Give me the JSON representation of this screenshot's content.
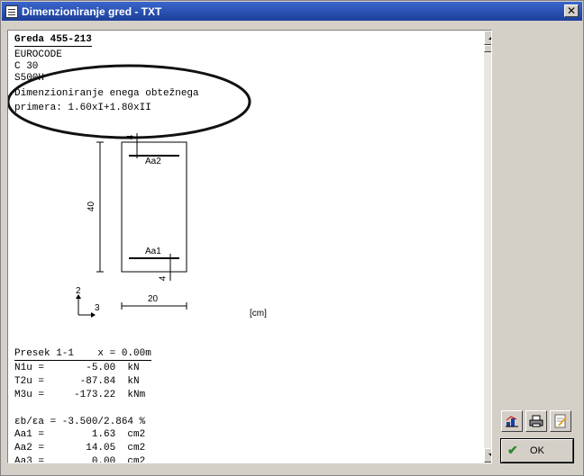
{
  "window": {
    "title": "Dimenzioniranje gred - TXT",
    "close": "✕"
  },
  "doc": {
    "heading": "Greda 455-213",
    "lines": [
      "EUROCODE",
      "C 30",
      "S500H",
      "Dimenzioniranje enega obtežnega",
      "primera: 1.60xI+1.80xII"
    ]
  },
  "figure": {
    "height_label": "40",
    "width_label": "20",
    "top_cover": "4",
    "bottom_cover": "4",
    "aa2": "Aa2",
    "aa1": "Aa1",
    "axis_2": "2",
    "axis_3": "3",
    "unit": "[cm]"
  },
  "section": {
    "header": "Presek 1-1    x = 0.00m",
    "rows": [
      "N1u =       -5.00  kN",
      "T2u =      -87.84  kN",
      "M3u =     -173.22  kNm",
      "",
      "εb/εa = -3.500/2.864 %",
      "Aa1 =        1.63  cm2",
      "Aa2 =       14.05  cm2",
      "Aa3 =        0.00  cm2"
    ]
  },
  "buttons": {
    "ok": "OK"
  },
  "icons": [
    "chart-icon",
    "printer-icon",
    "notepad-icon",
    "check-icon"
  ]
}
